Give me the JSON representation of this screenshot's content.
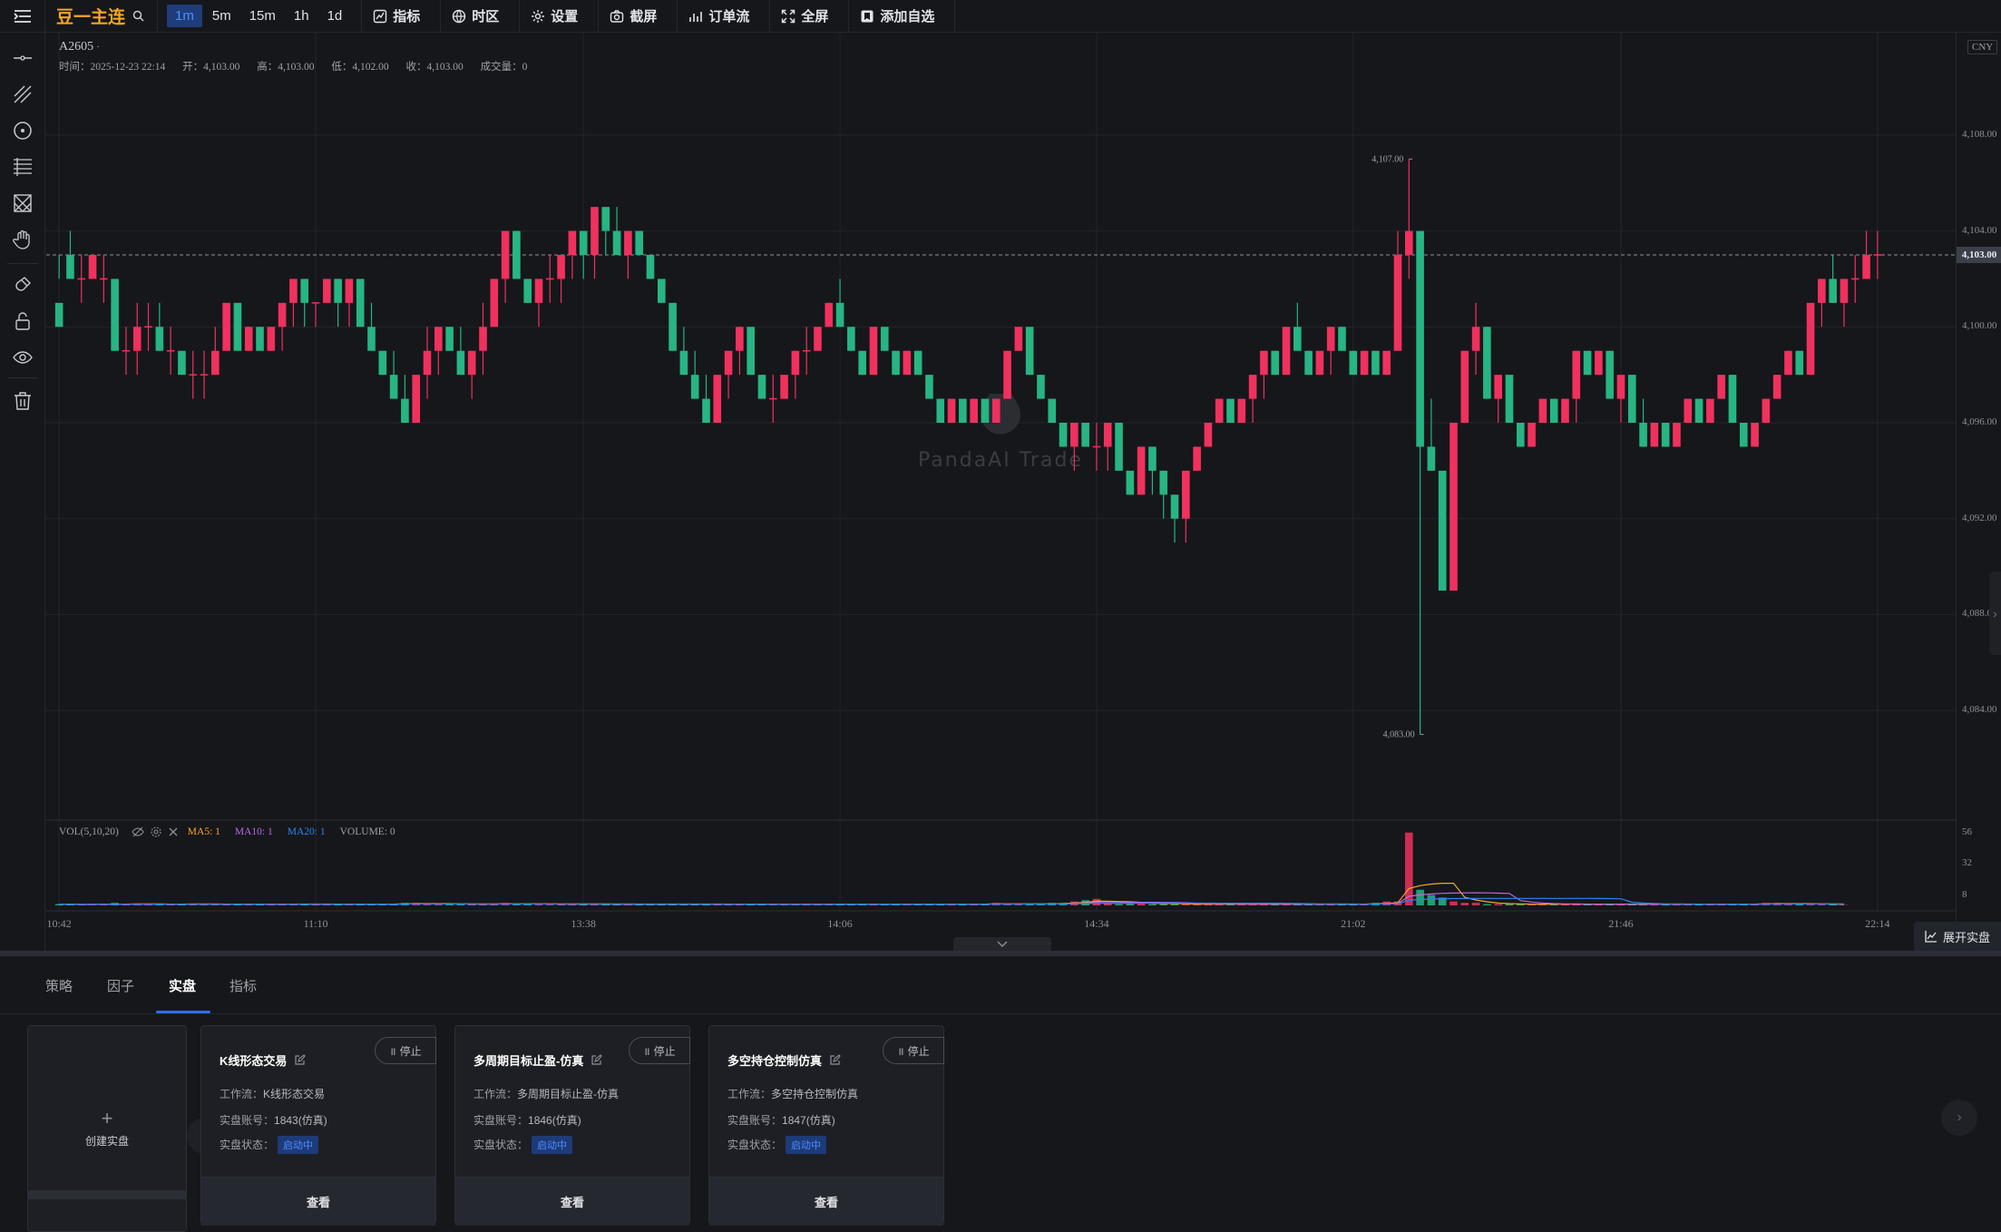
{
  "toolbar": {
    "symbol_name": "豆一主连",
    "periods": [
      "1m",
      "5m",
      "15m",
      "1h",
      "1d"
    ],
    "active_period": "1m",
    "buttons": {
      "indicator": "指标",
      "timezone": "时区",
      "settings": "设置",
      "screenshot": "截屏",
      "orderflow": "订单流",
      "fullscreen": "全屏",
      "add_watchlist": "添加自选"
    }
  },
  "left_tools": [
    "horizontal-line-icon",
    "trend-line-icon",
    "circle-target-icon",
    "fib-lines-icon",
    "pattern-icon",
    "hand-icon",
    "magnet-icon",
    "lock-icon",
    "eye-icon",
    "trash-icon"
  ],
  "legend": {
    "symbol": "A2605",
    "symbol_suffix": "·",
    "time": "时间：2025-12-23 22:14",
    "open": "开：4,103.00",
    "high": "高：4,103.00",
    "low": "低：4,102.00",
    "close": "收：4,103.00",
    "volume": "成交量：0"
  },
  "watermark": "PandaAI Trade",
  "y_axis": {
    "currency": "CNY",
    "labels": [
      "4,108.00",
      "4,104.00",
      "4,100.00",
      "4,096.00",
      "4,092.00",
      "4,088.00",
      "4,084.00"
    ],
    "last_price": "4,103.00",
    "vol_labels": [
      "56",
      "32",
      "8"
    ]
  },
  "volume_legend": {
    "name": "VOL(5,10,20)",
    "ma5": "MA5: 1",
    "ma10": "MA10: 1",
    "ma20": "MA20: 1",
    "volume": "VOLUME: 0"
  },
  "x_axis": [
    "10:42",
    "11:10",
    "13:38",
    "14:06",
    "14:34",
    "21:02",
    "21:46",
    "22:14"
  ],
  "expand_button": "展开实盘",
  "bottom": {
    "tabs": [
      "策略",
      "因子",
      "实盘",
      "指标"
    ],
    "active_tab": "实盘",
    "create_label": "创建实盘",
    "cards": [
      {
        "title": "K线形态交易",
        "stop": "停止",
        "workflow_label": "工作流：",
        "workflow": "K线形态交易",
        "account_label": "实盘账号：",
        "account": "1843(仿真)",
        "status_label": "实盘状态：",
        "status": "启动中",
        "view": "查看"
      },
      {
        "title": "多周期目标止盈-仿真",
        "stop": "停止",
        "workflow_label": "工作流：",
        "workflow": "多周期目标止盈-仿真",
        "account_label": "实盘账号：",
        "account": "1846(仿真)",
        "status_label": "实盘状态：",
        "status": "启动中",
        "view": "查看"
      },
      {
        "title": "多空持仓控制仿真",
        "stop": "停止",
        "workflow_label": "工作流：",
        "workflow": "多空持仓控制仿真",
        "account_label": "实盘账号：",
        "account": "1847(仿真)",
        "status_label": "实盘状态：",
        "status": "启动中",
        "view": "查看"
      }
    ]
  },
  "chart_data": {
    "type": "candlestick",
    "symbol": "A2605",
    "y_range": [
      4082,
      4110
    ],
    "last_price": 4103,
    "annotations": {
      "max": "4,107.00",
      "min": "4,083.00"
    },
    "colors": {
      "up": "#f0315e",
      "down": "#27b583",
      "ma5": "#f5a623",
      "ma10": "#b86ae0",
      "ma20": "#2f84f5",
      "grid": "#23252b"
    },
    "candles": [
      [
        4101,
        4103,
        4102,
        4100
      ],
      [
        4103,
        4104,
        4102,
        4102
      ],
      [
        4102,
        4103,
        4101,
        4102
      ],
      [
        4102,
        4103,
        4102,
        4103
      ],
      [
        4102,
        4103,
        4101,
        4102
      ],
      [
        4102,
        4102,
        4099,
        4099
      ],
      [
        4099,
        4100,
        4098,
        4099
      ],
      [
        4099,
        4101,
        4098,
        4100
      ],
      [
        4100,
        4101,
        4099,
        4100
      ],
      [
        4100,
        4101,
        4099,
        4099
      ],
      [
        4099,
        4100,
        4098,
        4099
      ],
      [
        4099,
        4099,
        4098,
        4098
      ],
      [
        4098,
        4099,
        4097,
        4098
      ],
      [
        4098,
        4099,
        4097,
        4098
      ],
      [
        4098,
        4100,
        4098,
        4099
      ],
      [
        4099,
        4101,
        4099,
        4101
      ],
      [
        4101,
        4101,
        4099,
        4099
      ],
      [
        4099,
        4100,
        4099,
        4100
      ],
      [
        4100,
        4100,
        4099,
        4099
      ],
      [
        4099,
        4100,
        4099,
        4100
      ],
      [
        4100,
        4101,
        4099,
        4101
      ],
      [
        4101,
        4102,
        4100,
        4102
      ],
      [
        4102,
        4102,
        4100,
        4101
      ],
      [
        4101,
        4101,
        4100,
        4101
      ],
      [
        4101,
        4102,
        4101,
        4102
      ],
      [
        4102,
        4102,
        4100,
        4101
      ],
      [
        4101,
        4102,
        4100,
        4102
      ],
      [
        4102,
        4102,
        4100,
        4100
      ],
      [
        4100,
        4101,
        4099,
        4099
      ],
      [
        4099,
        4099,
        4098,
        4098
      ],
      [
        4098,
        4099,
        4097,
        4097
      ],
      [
        4097,
        4098,
        4096,
        4096
      ],
      [
        4096,
        4098,
        4096,
        4098
      ],
      [
        4098,
        4100,
        4097,
        4099
      ],
      [
        4099,
        4100,
        4098,
        4100
      ],
      [
        4100,
        4100,
        4099,
        4099
      ],
      [
        4099,
        4100,
        4098,
        4098
      ],
      [
        4098,
        4099,
        4097,
        4099
      ],
      [
        4099,
        4101,
        4098,
        4100
      ],
      [
        4100,
        4102,
        4100,
        4102
      ],
      [
        4102,
        4104,
        4101,
        4104
      ],
      [
        4104,
        4104,
        4102,
        4102
      ],
      [
        4102,
        4102,
        4101,
        4101
      ],
      [
        4101,
        4102,
        4100,
        4102
      ],
      [
        4102,
        4103,
        4101,
        4102
      ],
      [
        4102,
        4103,
        4101,
        4103
      ],
      [
        4103,
        4104,
        4102,
        4104
      ],
      [
        4104,
        4104,
        4102,
        4103
      ],
      [
        4103,
        4105,
        4102,
        4105
      ],
      [
        4105,
        4105,
        4103,
        4104
      ],
      [
        4104,
        4105,
        4103,
        4103
      ],
      [
        4103,
        4104,
        4102,
        4104
      ],
      [
        4104,
        4104,
        4103,
        4103
      ],
      [
        4103,
        4103,
        4102,
        4102
      ],
      [
        4102,
        4102,
        4101,
        4101
      ],
      [
        4101,
        4101,
        4099,
        4099
      ],
      [
        4099,
        4100,
        4098,
        4098
      ],
      [
        4098,
        4099,
        4097,
        4097
      ],
      [
        4097,
        4098,
        4096,
        4096
      ],
      [
        4096,
        4098,
        4096,
        4098
      ],
      [
        4098,
        4099,
        4097,
        4099
      ],
      [
        4099,
        4100,
        4098,
        4100
      ],
      [
        4100,
        4100,
        4098,
        4098
      ],
      [
        4098,
        4098,
        4097,
        4097
      ],
      [
        4097,
        4098,
        4096,
        4097
      ],
      [
        4097,
        4098,
        4097,
        4098
      ],
      [
        4098,
        4099,
        4097,
        4099
      ],
      [
        4099,
        4100,
        4098,
        4099
      ],
      [
        4099,
        4100,
        4099,
        4100
      ],
      [
        4100,
        4101,
        4100,
        4101
      ],
      [
        4101,
        4102,
        4100,
        4100
      ],
      [
        4100,
        4100,
        4099,
        4099
      ],
      [
        4099,
        4099,
        4098,
        4098
      ],
      [
        4098,
        4100,
        4098,
        4100
      ],
      [
        4100,
        4100,
        4099,
        4099
      ],
      [
        4099,
        4099,
        4098,
        4098
      ],
      [
        4098,
        4099,
        4098,
        4099
      ],
      [
        4099,
        4099,
        4098,
        4098
      ],
      [
        4098,
        4098,
        4097,
        4097
      ],
      [
        4097,
        4097,
        4096,
        4096
      ],
      [
        4096,
        4097,
        4096,
        4097
      ],
      [
        4097,
        4097,
        4096,
        4096
      ],
      [
        4096,
        4097,
        4096,
        4097
      ],
      [
        4097,
        4097,
        4096,
        4096
      ],
      [
        4096,
        4097,
        4096,
        4097
      ],
      [
        4097,
        4099,
        4097,
        4099
      ],
      [
        4099,
        4100,
        4099,
        4100
      ],
      [
        4100,
        4100,
        4098,
        4098
      ],
      [
        4098,
        4098,
        4097,
        4097
      ],
      [
        4097,
        4097,
        4096,
        4096
      ],
      [
        4096,
        4096,
        4095,
        4095
      ],
      [
        4095,
        4096,
        4094,
        4096
      ],
      [
        4096,
        4096,
        4095,
        4095
      ],
      [
        4095,
        4096,
        4094,
        4095
      ],
      [
        4095,
        4096,
        4094,
        4096
      ],
      [
        4096,
        4096,
        4094,
        4094
      ],
      [
        4094,
        4094,
        4093,
        4093
      ],
      [
        4093,
        4095,
        4093,
        4095
      ],
      [
        4095,
        4095,
        4093,
        4094
      ],
      [
        4094,
        4094,
        4092,
        4093
      ],
      [
        4093,
        4093,
        4091,
        4092
      ],
      [
        4092,
        4094,
        4091,
        4094
      ],
      [
        4094,
        4095,
        4094,
        4095
      ],
      [
        4095,
        4096,
        4095,
        4096
      ],
      [
        4096,
        4097,
        4096,
        4097
      ],
      [
        4097,
        4097,
        4096,
        4096
      ],
      [
        4096,
        4097,
        4096,
        4097
      ],
      [
        4097,
        4098,
        4096,
        4098
      ],
      [
        4098,
        4099,
        4097,
        4099
      ],
      [
        4099,
        4099,
        4098,
        4098
      ],
      [
        4098,
        4100,
        4098,
        4100
      ],
      [
        4100,
        4101,
        4099,
        4099
      ],
      [
        4099,
        4099,
        4098,
        4098
      ],
      [
        4098,
        4099,
        4098,
        4099
      ],
      [
        4099,
        4100,
        4098,
        4100
      ],
      [
        4100,
        4100,
        4099,
        4099
      ],
      [
        4099,
        4099,
        4098,
        4098
      ],
      [
        4098,
        4099,
        4098,
        4099
      ],
      [
        4099,
        4099,
        4098,
        4098
      ],
      [
        4098,
        4099,
        4098,
        4099
      ],
      [
        4099,
        4104,
        4099,
        4103
      ],
      [
        4103,
        4107,
        4102,
        4104
      ],
      [
        4104,
        4104,
        4083,
        4095
      ],
      [
        4095,
        4097,
        4094,
        4094
      ],
      [
        4094,
        4094,
        4089,
        4089
      ],
      [
        4089,
        4096,
        4089,
        4096
      ],
      [
        4096,
        4099,
        4096,
        4099
      ],
      [
        4099,
        4101,
        4098,
        4100
      ],
      [
        4100,
        4100,
        4097,
        4097
      ],
      [
        4097,
        4098,
        4096,
        4098
      ],
      [
        4098,
        4098,
        4096,
        4096
      ],
      [
        4096,
        4096,
        4095,
        4095
      ],
      [
        4095,
        4096,
        4095,
        4096
      ],
      [
        4096,
        4097,
        4096,
        4097
      ],
      [
        4097,
        4097,
        4096,
        4096
      ],
      [
        4096,
        4097,
        4096,
        4097
      ],
      [
        4097,
        4099,
        4096,
        4099
      ],
      [
        4099,
        4099,
        4098,
        4098
      ],
      [
        4098,
        4099,
        4098,
        4099
      ],
      [
        4099,
        4099,
        4097,
        4097
      ],
      [
        4097,
        4098,
        4096,
        4098
      ],
      [
        4098,
        4098,
        4096,
        4096
      ],
      [
        4096,
        4097,
        4095,
        4095
      ],
      [
        4095,
        4096,
        4095,
        4096
      ],
      [
        4096,
        4096,
        4095,
        4095
      ],
      [
        4095,
        4096,
        4095,
        4096
      ],
      [
        4096,
        4097,
        4096,
        4097
      ],
      [
        4097,
        4097,
        4096,
        4096
      ],
      [
        4096,
        4097,
        4096,
        4097
      ],
      [
        4097,
        4098,
        4097,
        4098
      ],
      [
        4098,
        4098,
        4096,
        4096
      ],
      [
        4096,
        4096,
        4095,
        4095
      ],
      [
        4095,
        4096,
        4095,
        4096
      ],
      [
        4096,
        4097,
        4096,
        4097
      ],
      [
        4097,
        4098,
        4097,
        4098
      ],
      [
        4098,
        4099,
        4098,
        4099
      ],
      [
        4099,
        4099,
        4098,
        4098
      ],
      [
        4098,
        4101,
        4098,
        4101
      ],
      [
        4101,
        4102,
        4100,
        4102
      ],
      [
        4102,
        4103,
        4101,
        4101
      ],
      [
        4101,
        4102,
        4100,
        4102
      ],
      [
        4102,
        4103,
        4101,
        4102
      ],
      [
        4102,
        4104,
        4102,
        4103
      ],
      [
        4103,
        4104,
        4102,
        4103
      ]
    ],
    "volumes": [
      1,
      1,
      0,
      1,
      1,
      2,
      1,
      1,
      1,
      1,
      1,
      1,
      1,
      1,
      1,
      1,
      1,
      1,
      1,
      1,
      1,
      1,
      1,
      1,
      1,
      1,
      1,
      1,
      1,
      1,
      1,
      2,
      2,
      1,
      1,
      1,
      1,
      1,
      1,
      1,
      2,
      1,
      1,
      1,
      1,
      1,
      1,
      1,
      1,
      1,
      1,
      1,
      1,
      1,
      1,
      1,
      1,
      1,
      1,
      1,
      1,
      1,
      1,
      1,
      1,
      1,
      1,
      1,
      1,
      1,
      1,
      1,
      1,
      1,
      1,
      1,
      1,
      1,
      1,
      1,
      1,
      1,
      1,
      1,
      2,
      1,
      1,
      1,
      1,
      2,
      2,
      3,
      4,
      5,
      2,
      1,
      2,
      2,
      1,
      1,
      1,
      1,
      1,
      1,
      1,
      1,
      1,
      1,
      1,
      1,
      1,
      1,
      1,
      1,
      1,
      1,
      1,
      1,
      2,
      3,
      3,
      56,
      12,
      8,
      6,
      3,
      2,
      2,
      1,
      1,
      1,
      1,
      1,
      1,
      1,
      1,
      1,
      1,
      1,
      1,
      1,
      1,
      1,
      1,
      1,
      1,
      1,
      1,
      1,
      1,
      1,
      1,
      1,
      2,
      2,
      1,
      1,
      1,
      1,
      1,
      0
    ]
  }
}
